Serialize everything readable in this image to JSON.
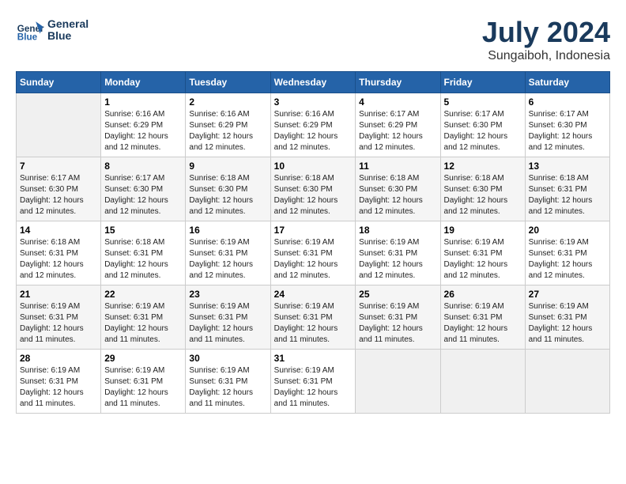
{
  "header": {
    "logo_line1": "General",
    "logo_line2": "Blue",
    "month_year": "July 2024",
    "location": "Sungaiboh, Indonesia"
  },
  "weekdays": [
    "Sunday",
    "Monday",
    "Tuesday",
    "Wednesday",
    "Thursday",
    "Friday",
    "Saturday"
  ],
  "weeks": [
    [
      {
        "day": "",
        "sunrise": "",
        "sunset": "",
        "daylight": ""
      },
      {
        "day": "1",
        "sunrise": "Sunrise: 6:16 AM",
        "sunset": "Sunset: 6:29 PM",
        "daylight": "Daylight: 12 hours and 12 minutes."
      },
      {
        "day": "2",
        "sunrise": "Sunrise: 6:16 AM",
        "sunset": "Sunset: 6:29 PM",
        "daylight": "Daylight: 12 hours and 12 minutes."
      },
      {
        "day": "3",
        "sunrise": "Sunrise: 6:16 AM",
        "sunset": "Sunset: 6:29 PM",
        "daylight": "Daylight: 12 hours and 12 minutes."
      },
      {
        "day": "4",
        "sunrise": "Sunrise: 6:17 AM",
        "sunset": "Sunset: 6:29 PM",
        "daylight": "Daylight: 12 hours and 12 minutes."
      },
      {
        "day": "5",
        "sunrise": "Sunrise: 6:17 AM",
        "sunset": "Sunset: 6:30 PM",
        "daylight": "Daylight: 12 hours and 12 minutes."
      },
      {
        "day": "6",
        "sunrise": "Sunrise: 6:17 AM",
        "sunset": "Sunset: 6:30 PM",
        "daylight": "Daylight: 12 hours and 12 minutes."
      }
    ],
    [
      {
        "day": "7",
        "sunrise": "Sunrise: 6:17 AM",
        "sunset": "Sunset: 6:30 PM",
        "daylight": "Daylight: 12 hours and 12 minutes."
      },
      {
        "day": "8",
        "sunrise": "Sunrise: 6:17 AM",
        "sunset": "Sunset: 6:30 PM",
        "daylight": "Daylight: 12 hours and 12 minutes."
      },
      {
        "day": "9",
        "sunrise": "Sunrise: 6:18 AM",
        "sunset": "Sunset: 6:30 PM",
        "daylight": "Daylight: 12 hours and 12 minutes."
      },
      {
        "day": "10",
        "sunrise": "Sunrise: 6:18 AM",
        "sunset": "Sunset: 6:30 PM",
        "daylight": "Daylight: 12 hours and 12 minutes."
      },
      {
        "day": "11",
        "sunrise": "Sunrise: 6:18 AM",
        "sunset": "Sunset: 6:30 PM",
        "daylight": "Daylight: 12 hours and 12 minutes."
      },
      {
        "day": "12",
        "sunrise": "Sunrise: 6:18 AM",
        "sunset": "Sunset: 6:30 PM",
        "daylight": "Daylight: 12 hours and 12 minutes."
      },
      {
        "day": "13",
        "sunrise": "Sunrise: 6:18 AM",
        "sunset": "Sunset: 6:31 PM",
        "daylight": "Daylight: 12 hours and 12 minutes."
      }
    ],
    [
      {
        "day": "14",
        "sunrise": "Sunrise: 6:18 AM",
        "sunset": "Sunset: 6:31 PM",
        "daylight": "Daylight: 12 hours and 12 minutes."
      },
      {
        "day": "15",
        "sunrise": "Sunrise: 6:18 AM",
        "sunset": "Sunset: 6:31 PM",
        "daylight": "Daylight: 12 hours and 12 minutes."
      },
      {
        "day": "16",
        "sunrise": "Sunrise: 6:19 AM",
        "sunset": "Sunset: 6:31 PM",
        "daylight": "Daylight: 12 hours and 12 minutes."
      },
      {
        "day": "17",
        "sunrise": "Sunrise: 6:19 AM",
        "sunset": "Sunset: 6:31 PM",
        "daylight": "Daylight: 12 hours and 12 minutes."
      },
      {
        "day": "18",
        "sunrise": "Sunrise: 6:19 AM",
        "sunset": "Sunset: 6:31 PM",
        "daylight": "Daylight: 12 hours and 12 minutes."
      },
      {
        "day": "19",
        "sunrise": "Sunrise: 6:19 AM",
        "sunset": "Sunset: 6:31 PM",
        "daylight": "Daylight: 12 hours and 12 minutes."
      },
      {
        "day": "20",
        "sunrise": "Sunrise: 6:19 AM",
        "sunset": "Sunset: 6:31 PM",
        "daylight": "Daylight: 12 hours and 12 minutes."
      }
    ],
    [
      {
        "day": "21",
        "sunrise": "Sunrise: 6:19 AM",
        "sunset": "Sunset: 6:31 PM",
        "daylight": "Daylight: 12 hours and 11 minutes."
      },
      {
        "day": "22",
        "sunrise": "Sunrise: 6:19 AM",
        "sunset": "Sunset: 6:31 PM",
        "daylight": "Daylight: 12 hours and 11 minutes."
      },
      {
        "day": "23",
        "sunrise": "Sunrise: 6:19 AM",
        "sunset": "Sunset: 6:31 PM",
        "daylight": "Daylight: 12 hours and 11 minutes."
      },
      {
        "day": "24",
        "sunrise": "Sunrise: 6:19 AM",
        "sunset": "Sunset: 6:31 PM",
        "daylight": "Daylight: 12 hours and 11 minutes."
      },
      {
        "day": "25",
        "sunrise": "Sunrise: 6:19 AM",
        "sunset": "Sunset: 6:31 PM",
        "daylight": "Daylight: 12 hours and 11 minutes."
      },
      {
        "day": "26",
        "sunrise": "Sunrise: 6:19 AM",
        "sunset": "Sunset: 6:31 PM",
        "daylight": "Daylight: 12 hours and 11 minutes."
      },
      {
        "day": "27",
        "sunrise": "Sunrise: 6:19 AM",
        "sunset": "Sunset: 6:31 PM",
        "daylight": "Daylight: 12 hours and 11 minutes."
      }
    ],
    [
      {
        "day": "28",
        "sunrise": "Sunrise: 6:19 AM",
        "sunset": "Sunset: 6:31 PM",
        "daylight": "Daylight: 12 hours and 11 minutes."
      },
      {
        "day": "29",
        "sunrise": "Sunrise: 6:19 AM",
        "sunset": "Sunset: 6:31 PM",
        "daylight": "Daylight: 12 hours and 11 minutes."
      },
      {
        "day": "30",
        "sunrise": "Sunrise: 6:19 AM",
        "sunset": "Sunset: 6:31 PM",
        "daylight": "Daylight: 12 hours and 11 minutes."
      },
      {
        "day": "31",
        "sunrise": "Sunrise: 6:19 AM",
        "sunset": "Sunset: 6:31 PM",
        "daylight": "Daylight: 12 hours and 11 minutes."
      },
      {
        "day": "",
        "sunrise": "",
        "sunset": "",
        "daylight": ""
      },
      {
        "day": "",
        "sunrise": "",
        "sunset": "",
        "daylight": ""
      },
      {
        "day": "",
        "sunrise": "",
        "sunset": "",
        "daylight": ""
      }
    ]
  ]
}
